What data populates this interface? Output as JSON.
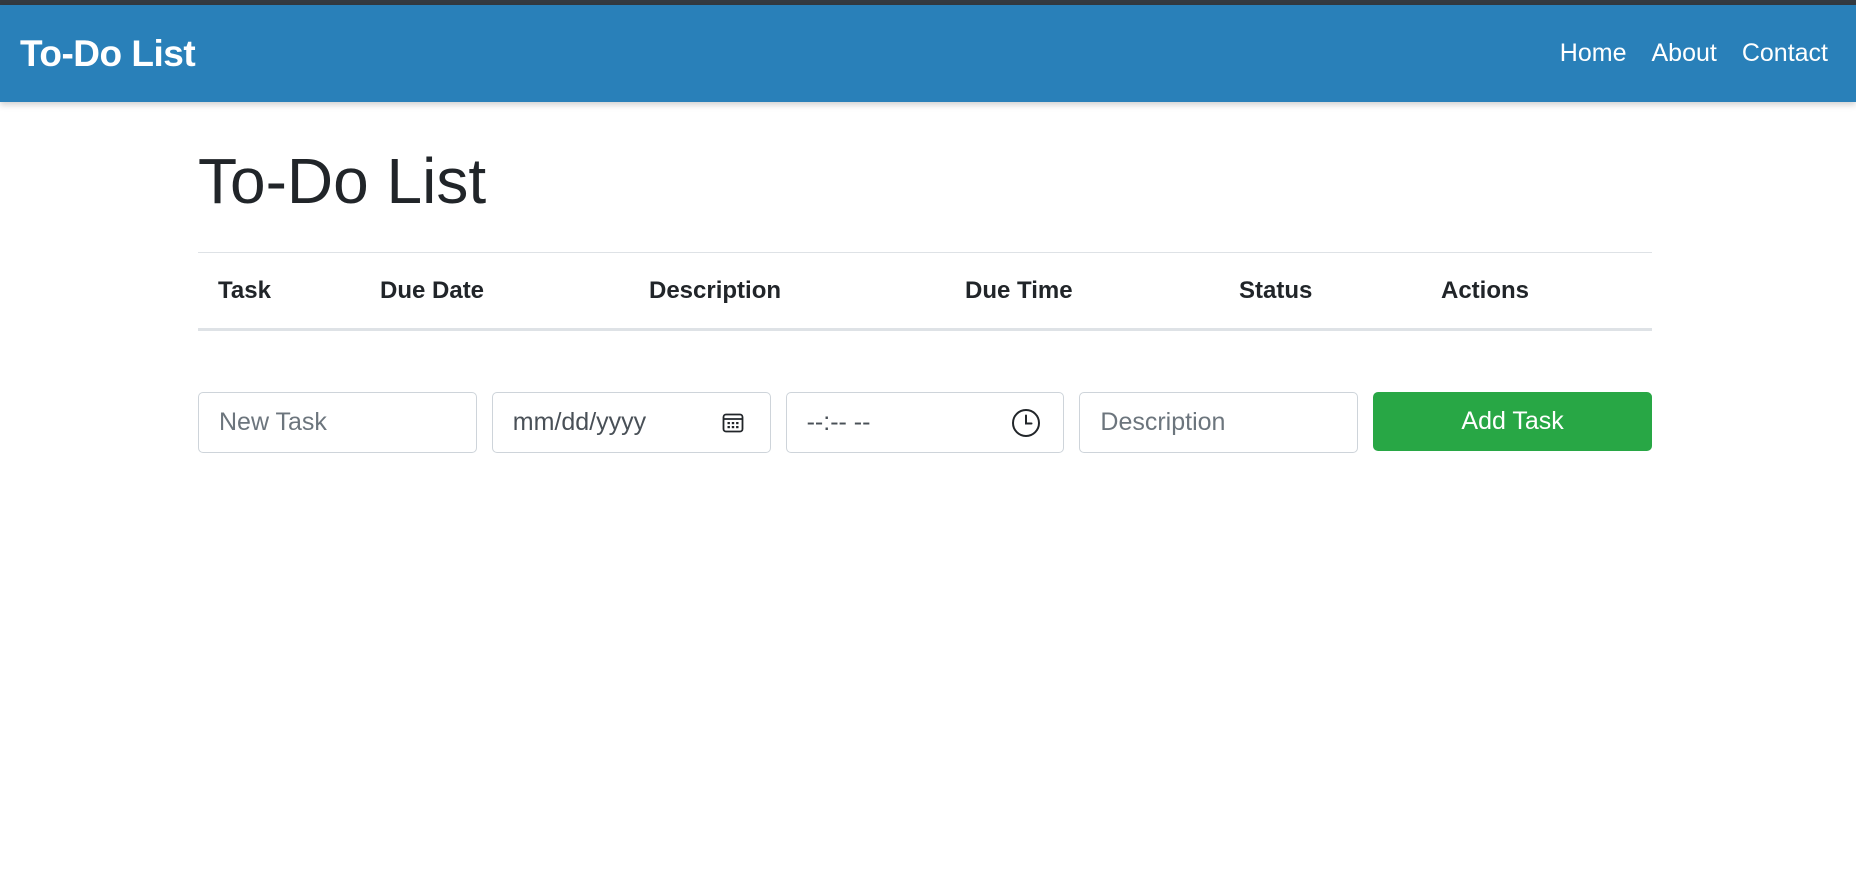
{
  "navbar": {
    "brand": "To-Do List",
    "links": [
      {
        "label": "Home"
      },
      {
        "label": "About"
      },
      {
        "label": "Contact"
      }
    ],
    "color": "#2980b9"
  },
  "main": {
    "title": "To-Do List",
    "table": {
      "columns": [
        "Task",
        "Due Date",
        "Description",
        "Due Time",
        "Status",
        "Actions"
      ],
      "rows": []
    },
    "form": {
      "task_placeholder": "New Task",
      "date_placeholder": "mm/dd/yyyy",
      "date_icon": "calendar-icon",
      "time_placeholder": "--:-- --",
      "time_icon": "clock-icon",
      "description_placeholder": "Description",
      "add_button_label": "Add Task",
      "add_button_color": "#28a745"
    }
  }
}
